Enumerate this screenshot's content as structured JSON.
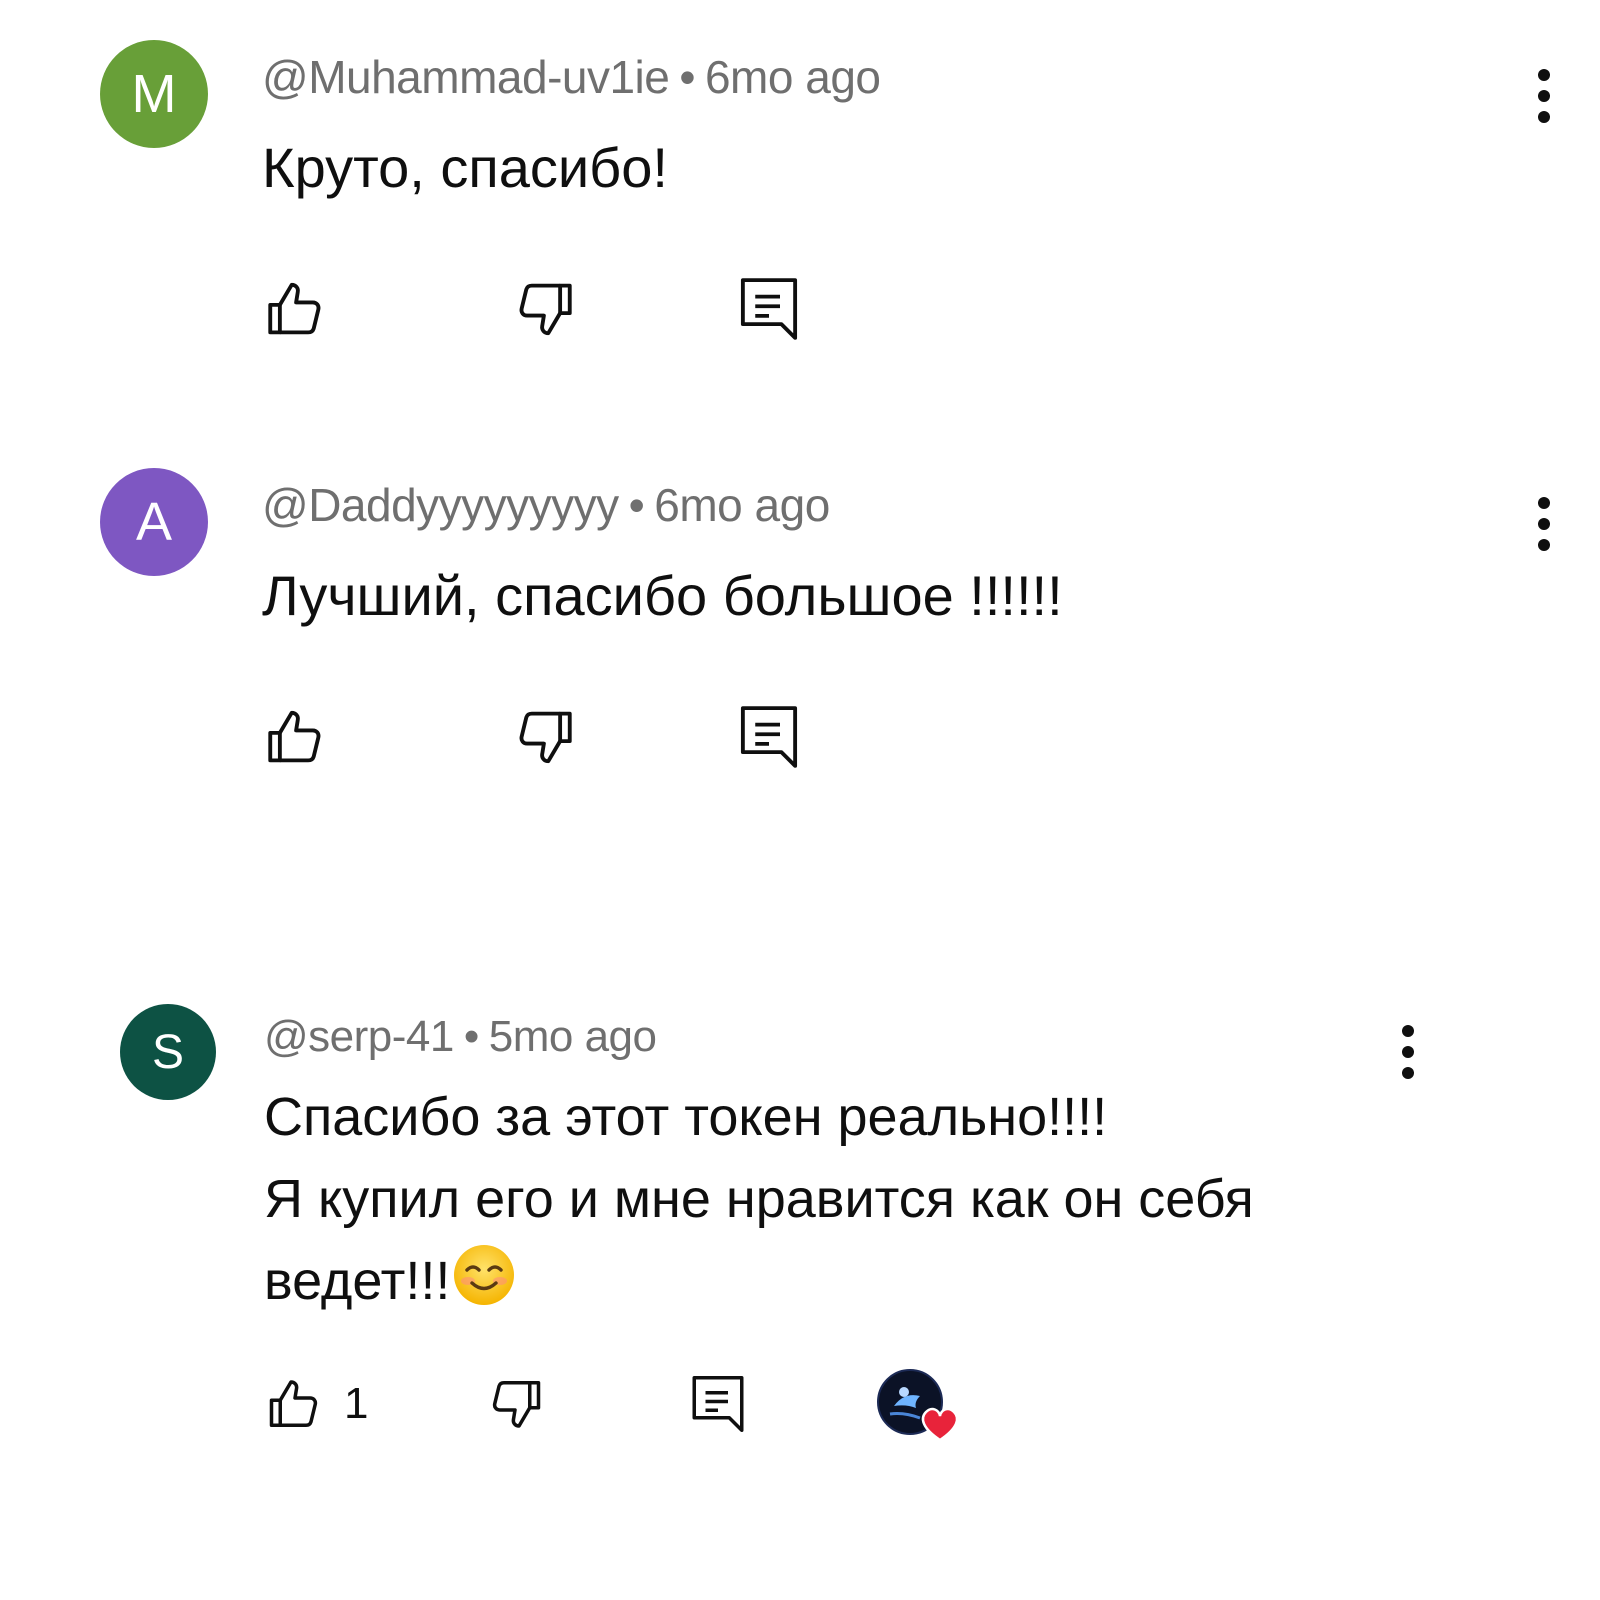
{
  "comments": [
    {
      "avatar_letter": "M",
      "avatar_color": "#689f38",
      "author": "@Muhammad-uv1ie",
      "separator": "•",
      "time": "6mo ago",
      "lines": [
        "Круто, спасибо!"
      ],
      "like_count": ""
    },
    {
      "avatar_letter": "A",
      "avatar_color": "#7e57c2",
      "author": "@Daddyyyyyyyyy",
      "separator": "•",
      "time": "6mo ago",
      "lines": [
        "Лучший, спасибо большое !!!!!!"
      ],
      "like_count": ""
    },
    {
      "avatar_letter": "S",
      "avatar_color": "#0d5244",
      "author": "@serp-41",
      "separator": "•",
      "time": "5mo ago",
      "lines": [
        "Спасибо за этот токен реально!!!!",
        "Я купил его и мне нравится как он себя",
        "ведет!!!"
      ],
      "like_count": "1",
      "has_creator_heart": true
    }
  ],
  "icons": {
    "like": "thumbs-up-icon",
    "dislike": "thumbs-down-icon",
    "reply": "reply-icon",
    "more": "more-vert-icon",
    "emoji": "smiling-face-emoji",
    "heart": "creator-heart-icon"
  },
  "colors": {
    "meta_text": "#6f6f6f",
    "body_text": "#0f0f0f",
    "heart": "#e8233a"
  }
}
